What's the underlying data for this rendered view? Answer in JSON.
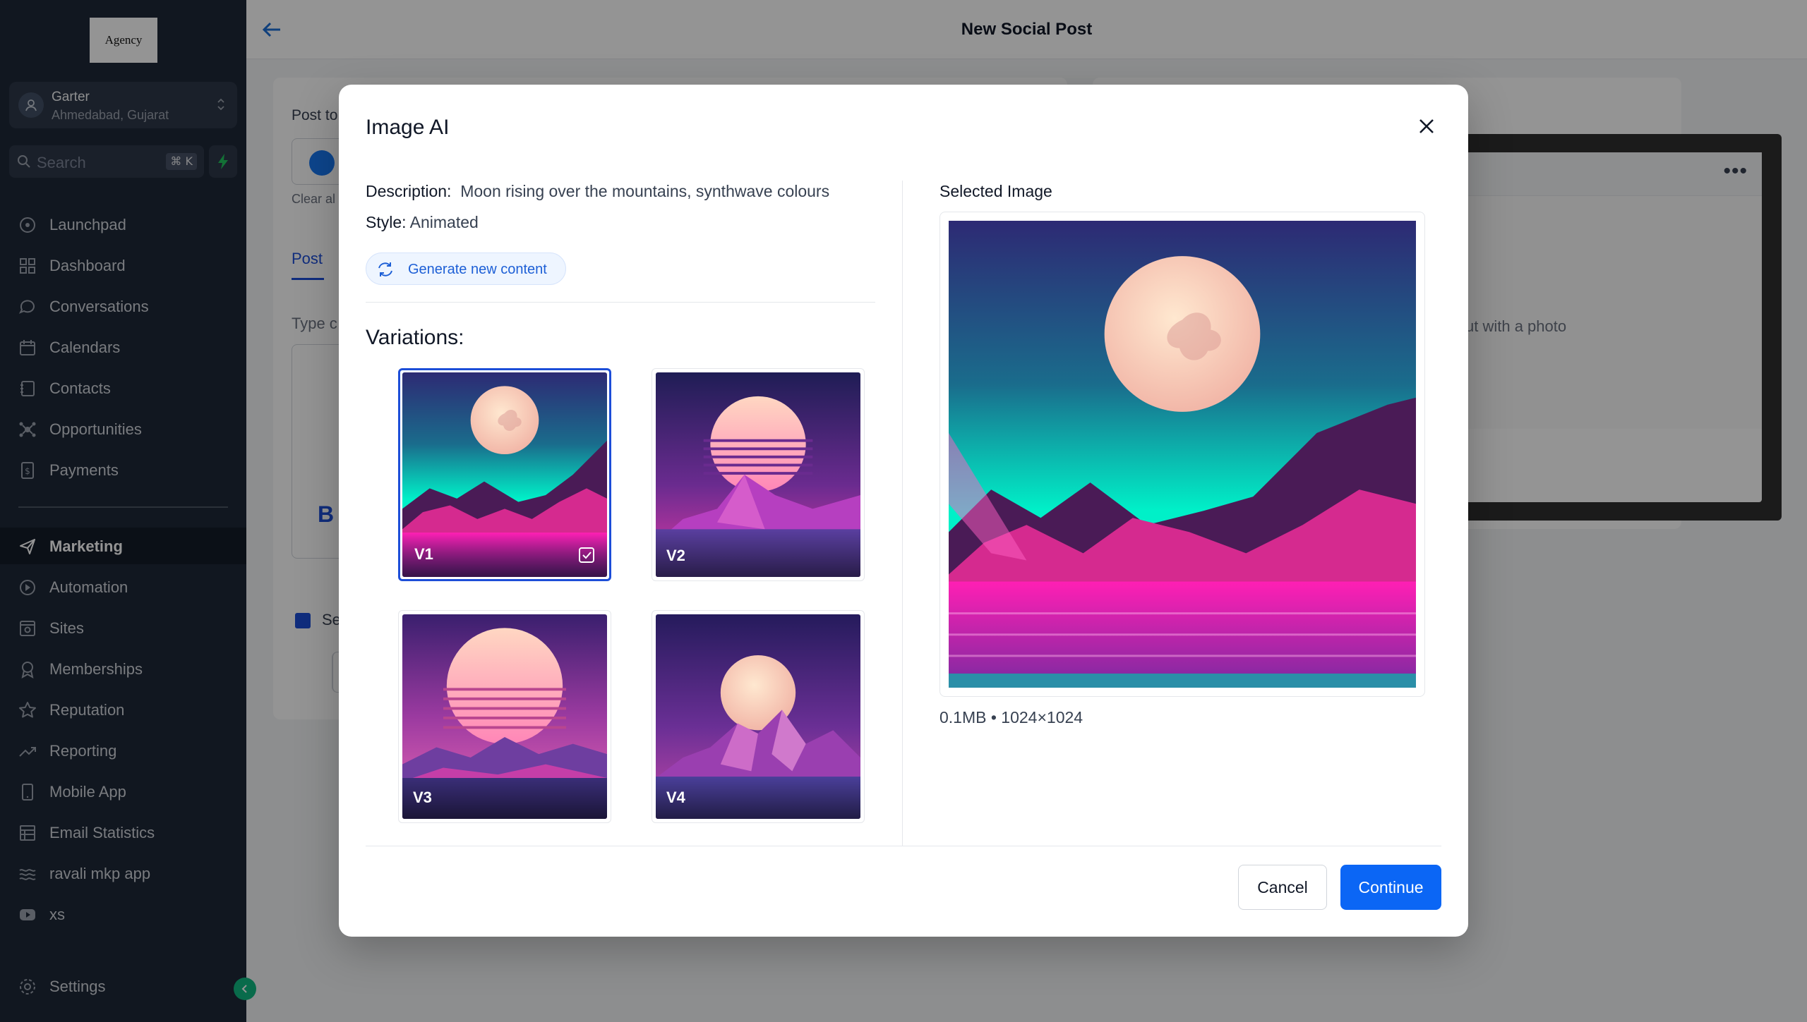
{
  "sidebar": {
    "logo_text": "Agency",
    "account": {
      "name": "Garter",
      "location": "Ahmedabad, Gujarat"
    },
    "search": {
      "placeholder": "Search",
      "shortcut": "⌘ K"
    },
    "items": [
      {
        "label": "Launchpad",
        "icon": "rocket-icon"
      },
      {
        "label": "Dashboard",
        "icon": "grid-icon"
      },
      {
        "label": "Conversations",
        "icon": "chat-icon"
      },
      {
        "label": "Calendars",
        "icon": "calendar-icon"
      },
      {
        "label": "Contacts",
        "icon": "contacts-icon"
      },
      {
        "label": "Opportunities",
        "icon": "opportunities-icon"
      },
      {
        "label": "Payments",
        "icon": "payments-icon"
      },
      {
        "label": "Marketing",
        "icon": "send-icon",
        "active": true
      },
      {
        "label": "Automation",
        "icon": "automation-icon"
      },
      {
        "label": "Sites",
        "icon": "sites-icon"
      },
      {
        "label": "Memberships",
        "icon": "badge-icon"
      },
      {
        "label": "Reputation",
        "icon": "star-icon"
      },
      {
        "label": "Reporting",
        "icon": "trend-icon"
      },
      {
        "label": "Mobile App",
        "icon": "phone-icon"
      },
      {
        "label": "Email Statistics",
        "icon": "email-stats-icon"
      },
      {
        "label": "ravali mkp app",
        "icon": "waves-icon"
      },
      {
        "label": "xs",
        "icon": "video-icon"
      }
    ],
    "settings_label": "Settings"
  },
  "page": {
    "title": "New Social Post",
    "post_to_label": "Post to",
    "clear_all": "Clear al",
    "tab_post": "Post",
    "type_hint": "Type c",
    "editor_bold": "B",
    "se_label": "Se",
    "preview_hint": "ut with a photo"
  },
  "modal": {
    "title": "Image AI",
    "description_label": "Description:",
    "description_value": "Moon rising over the mountains, synthwave colours",
    "style_label": "Style:",
    "style_value": "Animated",
    "generate_label": "Generate new content",
    "variations_label": "Variations:",
    "variations": [
      {
        "label": "V1",
        "selected": true
      },
      {
        "label": "V2",
        "selected": false
      },
      {
        "label": "V3",
        "selected": false
      },
      {
        "label": "V4",
        "selected": false
      }
    ],
    "selected_label": "Selected Image",
    "selected_meta": "0.1MB • 1024×1024",
    "cancel_label": "Cancel",
    "continue_label": "Continue"
  },
  "colors": {
    "sidebar_bg": "#1e2838",
    "accent": "#0b66f5",
    "selection": "#1d4ed8",
    "synth_cyan": "#00f0c8",
    "synth_magenta": "#ff1fb4",
    "synth_purple": "#3a1f6e"
  }
}
